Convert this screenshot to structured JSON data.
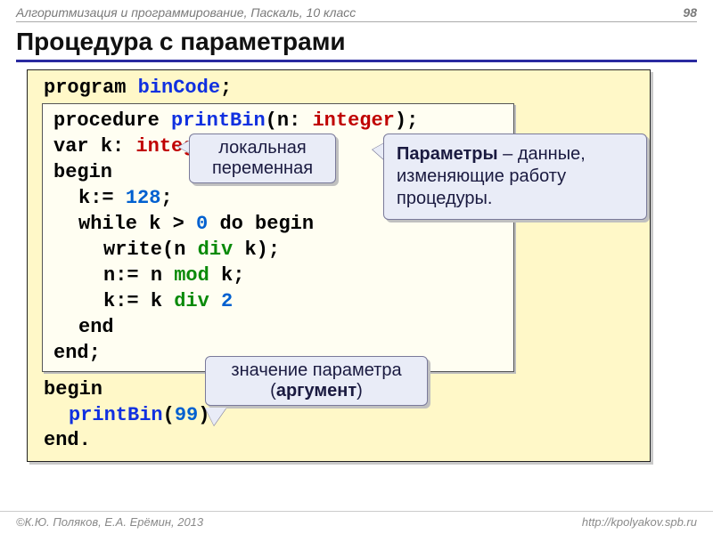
{
  "header": {
    "left": "Алгоритмизация и программирование, Паскаль, 10 класс",
    "page": "98"
  },
  "title": "Процедура с параметрами",
  "code": {
    "program_kw": "program",
    "program_id": "binCode",
    "semi": ";",
    "proc_kw": "procedure",
    "proc_id": "printBin",
    "lp": "(",
    "param_n": "n",
    "colon": ": ",
    "int_ty": "integer",
    "rp": ")",
    "var_kw": "var",
    "var_k": "k:",
    "begin_kw": "begin",
    "assign_k": "k:=",
    "v128": "128",
    "while_kw": "while",
    "k_name": "k",
    "gt": ">",
    "zero": "0",
    "do_kw": "do",
    "begin2": "begin",
    "write": "write(",
    "n_name": "n",
    "div_kw": "div",
    "rp2": ");",
    "assign_n": "n:=",
    "mod_kw": "mod",
    "k_semi": ";",
    "assign_k2": "k:=",
    "div_kw2": "div",
    "two": "2",
    "end_kw": "end",
    "end_semi": "end;",
    "call_id": "printBin",
    "lp2": "(",
    "v99": "99",
    "rp3": ")",
    "end_dot": "end."
  },
  "callouts": {
    "local_var": "локальная переменная",
    "params_bold": "Параметры",
    "params_rest": " – данные, изменяющие работу процедуры.",
    "arg_line1": "значение параметра",
    "arg_lp": "(",
    "arg_bold": "аргумент",
    "arg_rp": ")"
  },
  "footer": {
    "left": "©К.Ю. Поляков, Е.А. Ерёмин, 2013",
    "right": "http://kpolyakov.spb.ru"
  }
}
